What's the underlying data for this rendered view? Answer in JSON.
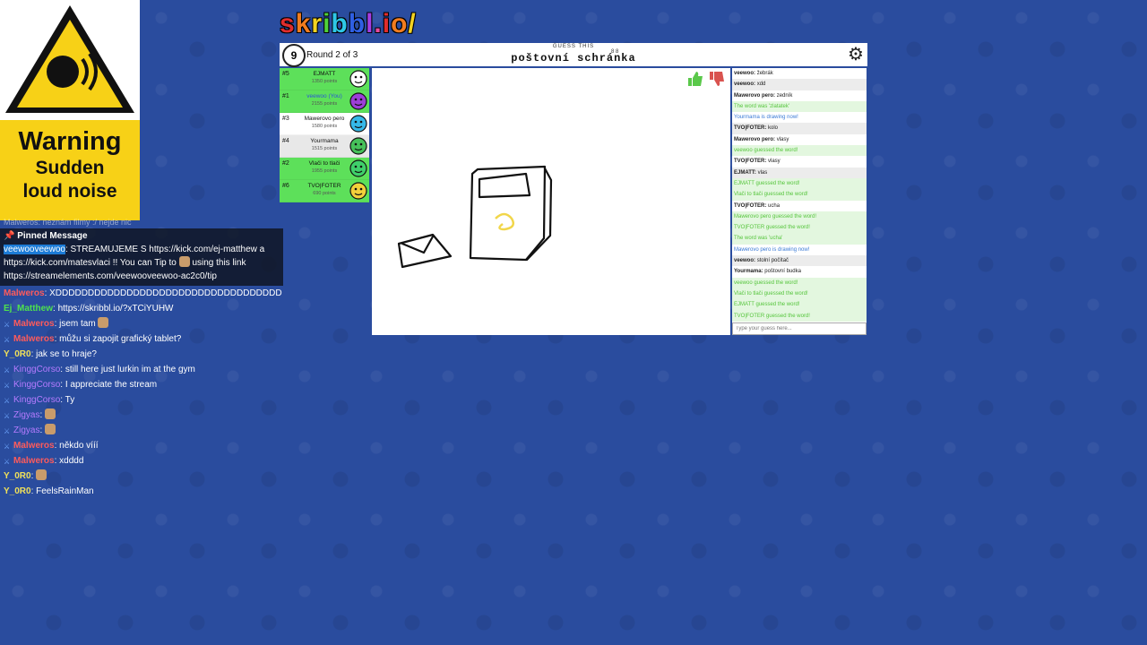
{
  "warning": {
    "title": "Warning",
    "line1": "Sudden",
    "line2": "loud noise"
  },
  "logo": {
    "letters": [
      "s",
      "k",
      "r",
      "i",
      "b",
      "b",
      "l",
      ".",
      "i",
      "o",
      "/"
    ]
  },
  "header": {
    "timer": "9",
    "round": "Round 2 of 3",
    "guess_label": "GUESS THIS",
    "word": "poštovní schránka",
    "word_lengths": "8 8"
  },
  "players": [
    {
      "rank": "#5",
      "name": "EJMATT",
      "points": "1350 points",
      "bg": "green",
      "you": false,
      "avatar": "#ffffff"
    },
    {
      "rank": "#1",
      "name": "veewoo (You)",
      "points": "2155 points",
      "bg": "green",
      "you": true,
      "avatar": "#9c3fd8"
    },
    {
      "rank": "#3",
      "name": "Mawerovo pero",
      "points": "1580 points",
      "bg": "white",
      "you": false,
      "avatar": "#35b8e8"
    },
    {
      "rank": "#4",
      "name": "Yourmama",
      "points": "1515 points",
      "bg": "grey",
      "you": false,
      "avatar": "#46c05a"
    },
    {
      "rank": "#2",
      "name": "Vlači to tlači",
      "points": "1955 points",
      "bg": "green",
      "you": false,
      "avatar": "#3fcf6a"
    },
    {
      "rank": "#6",
      "name": "TVO|FOTER",
      "points": "690 points",
      "bg": "green",
      "you": false,
      "avatar": "#f2d03b"
    }
  ],
  "game_chat": [
    {
      "user": "veewoo",
      "text": "žebrák",
      "type": "normal"
    },
    {
      "user": "veewoo",
      "text": "xdd",
      "type": "normal"
    },
    {
      "user": "Mawerovo pero",
      "text": "zedník",
      "type": "normal"
    },
    {
      "user": "",
      "text": "The word was 'zlatatek'",
      "type": "ok"
    },
    {
      "user": "",
      "text": "Yourmama is drawing now!",
      "type": "info"
    },
    {
      "user": "TVO|FOTER",
      "text": "kolo",
      "type": "normal"
    },
    {
      "user": "Mawerovo pero",
      "text": "vlasy",
      "type": "normal"
    },
    {
      "user": "",
      "text": "veewoo guessed the word!",
      "type": "ok"
    },
    {
      "user": "TVO|FOTER",
      "text": "vlasy",
      "type": "normal"
    },
    {
      "user": "EJMATT",
      "text": "vlas",
      "type": "normal"
    },
    {
      "user": "",
      "text": "EJMATT guessed the word!",
      "type": "ok"
    },
    {
      "user": "",
      "text": "Vlači to tlači guessed the word!",
      "type": "ok"
    },
    {
      "user": "TVO|FOTER",
      "text": "ucha",
      "type": "normal"
    },
    {
      "user": "",
      "text": "Mawerovo pero guessed the word!",
      "type": "ok"
    },
    {
      "user": "",
      "text": "TVO|FOTER guessed the word!",
      "type": "ok"
    },
    {
      "user": "",
      "text": "The word was 'ucha'",
      "type": "ok"
    },
    {
      "user": "",
      "text": "Mawerovo pero is drawing now!",
      "type": "info"
    },
    {
      "user": "veewoo",
      "text": "stolní počítač",
      "type": "normal"
    },
    {
      "user": "Yourmama",
      "text": "poštovní budka",
      "type": "normal"
    },
    {
      "user": "",
      "text": "veewoo guessed the word!",
      "type": "ok"
    },
    {
      "user": "",
      "text": "Vlači to tlači guessed the word!",
      "type": "ok"
    },
    {
      "user": "",
      "text": "EJMATT guessed the word!",
      "type": "ok"
    },
    {
      "user": "",
      "text": "TVO|FOTER guessed the word!",
      "type": "ok"
    }
  ],
  "guess_placeholder": "Type your guess here...",
  "stream_chat": {
    "faded_top": "Malweros: neznám filmy :/ nejde nic",
    "pinned_title": "Pinned Message",
    "pinned_user": "veewooveewoo",
    "pinned_text": ": STREAMUJEME S https://kick.com/ej-matthew a https://kick.com/matesvlaci !! You can Tip to",
    "pinned_text2": "using this link https://streamelements.com/veewooveewoo-ac2c0/tip",
    "messages": [
      {
        "user": "Malweros",
        "text": ": XDDDDDDDDDDDDDDDDDDDDDDDDDDDDDDDDDDD",
        "color": "red",
        "badges": false,
        "emote": false
      },
      {
        "user": "Ej_Matthew",
        "text": ": https://skribbl.io/?xTCiYUHW",
        "color": "green",
        "badges": false,
        "emote": false
      },
      {
        "user": "Malweros",
        "text": ": jsem tam",
        "color": "red",
        "badges": true,
        "emote": true
      },
      {
        "user": "Malweros",
        "text": ": můžu si zapojit grafický tablet?",
        "color": "red",
        "badges": true,
        "emote": false
      },
      {
        "user": "Y_0R0",
        "text": ": jak se to hraje?",
        "color": "yellow",
        "badges": false,
        "emote": false
      },
      {
        "user": "KinggCorso",
        "text": ": still here just lurkin im at the gym",
        "color": "purple",
        "badges": true,
        "emote": false
      },
      {
        "user": "KinggCorso",
        "text": ": I appreciate the stream",
        "color": "purple",
        "badges": true,
        "emote": false
      },
      {
        "user": "KinggCorso",
        "text": ": Ty",
        "color": "purple",
        "badges": true,
        "emote": false
      },
      {
        "user": "Zigyas",
        "text": ":",
        "color": "grey",
        "badges": true,
        "emote": true
      },
      {
        "user": "Zigyas",
        "text": ":",
        "color": "grey",
        "badges": true,
        "emote": true
      },
      {
        "user": "Malweros",
        "text": ": někdo vííí",
        "color": "red",
        "badges": true,
        "emote": false
      },
      {
        "user": "Malweros",
        "text": ": xdddd",
        "color": "red",
        "badges": true,
        "emote": false
      },
      {
        "user": "Y_0R0",
        "text": ":",
        "color": "yellow",
        "badges": false,
        "emote": true
      },
      {
        "user": "Y_0R0",
        "text": ": FeelsRainMan",
        "color": "yellow",
        "badges": false,
        "emote": false
      }
    ]
  }
}
